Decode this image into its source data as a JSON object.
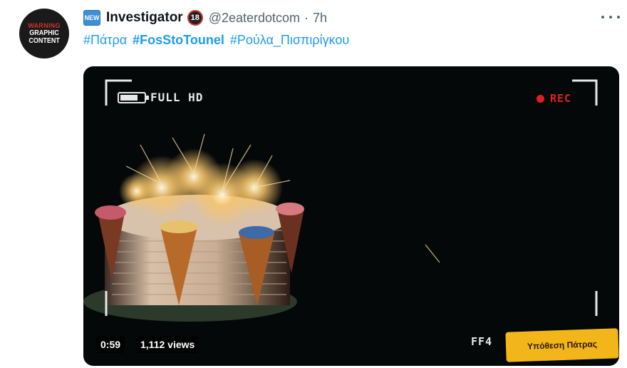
{
  "tweet": {
    "avatar": {
      "line_warn": "WARNING",
      "line1": "GRAPHIC",
      "line2": "CONTENT"
    },
    "new_badge": "NEW",
    "display_name": "Investigator",
    "age_badge": "18",
    "handle": "@2eaterdotcom",
    "separator": "·",
    "time": "7h",
    "hashtags": [
      {
        "text": "#Πάτρα",
        "bold": false
      },
      {
        "text": "#FosStoTounel",
        "bold": true
      },
      {
        "text": "#Ρούλα_Πισπιρίγκου",
        "bold": false
      }
    ]
  },
  "video": {
    "hud_left": "FULL HD",
    "hud_rec": "REC",
    "hud_bottom": "FF4",
    "battery_level": 0.75,
    "banner": "Υπόθεση Πάτρας",
    "duration": "0:59",
    "views": "1,112 views"
  },
  "colors": {
    "link": "#1d9bf0",
    "muted": "#536471",
    "rec_red": "#e02020",
    "banner_yellow": "#f2b51a"
  },
  "icons": {
    "more": "more-dots-icon",
    "battery": "battery-icon",
    "rec": "rec-dot-icon",
    "new": "new-badge-icon",
    "age": "age-18-icon"
  }
}
